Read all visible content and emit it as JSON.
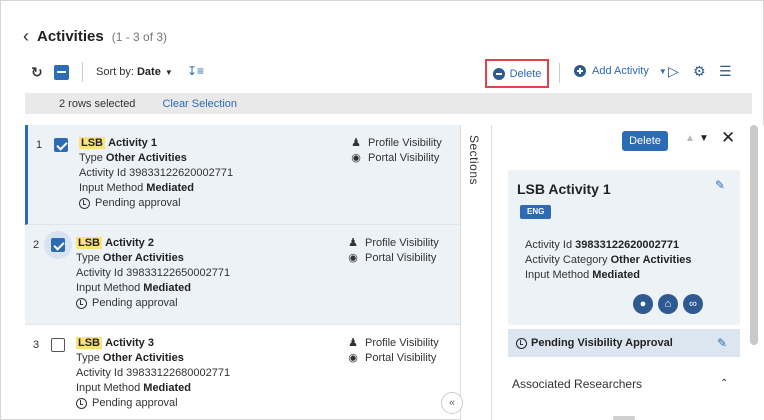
{
  "header": {
    "title": "Activities",
    "count": "(1 - 3 of 3)"
  },
  "toolbar": {
    "sort_by_label": "Sort by:",
    "sort_by_value": "Date",
    "delete_label": "Delete",
    "add_activity_label": "Add Activity"
  },
  "selection": {
    "rows_selected": "2 rows selected",
    "clear_label": "Clear Selection"
  },
  "rows": [
    {
      "num": "1",
      "tag": "LSB",
      "title": "Activity 1",
      "type_label": "Type",
      "type_value": "Other Activities",
      "activity_id": "Activity Id 39833122620002771",
      "input_label": "Input Method",
      "input_value": "Mediated",
      "status": "Pending approval",
      "profile_visibility": "Profile Visibility",
      "portal_visibility": "Portal Visibility",
      "checked": true
    },
    {
      "num": "2",
      "tag": "LSB",
      "title": "Activity 2",
      "type_label": "Type",
      "type_value": "Other Activities",
      "activity_id": "Activity Id 39833122650002771",
      "input_label": "Input Method",
      "input_value": "Mediated",
      "status": "Pending approval",
      "profile_visibility": "Profile Visibility",
      "portal_visibility": "Portal Visibility",
      "checked": true
    },
    {
      "num": "3",
      "tag": "LSB",
      "title": "Activity 3",
      "type_label": "Type",
      "type_value": "Other Activities",
      "activity_id": "Activity Id 39833122680002771",
      "input_label": "Input Method",
      "input_value": "Mediated",
      "status": "Pending approval",
      "profile_visibility": "Profile Visibility",
      "portal_visibility": "Portal Visibility",
      "checked": false
    }
  ],
  "sections_label": "Sections",
  "detail": {
    "delete_label": "Delete",
    "title": "LSB Activity 1",
    "lang_badge": "ENG",
    "activity_id_label": "Activity Id",
    "activity_id_value": "39833122620002771",
    "category_label": "Activity Category",
    "category_value": "Other Activities",
    "input_label": "Input Method",
    "input_value": "Mediated",
    "pending_visibility": "Pending Visibility Approval",
    "associated_researchers": "Associated Researchers"
  },
  "colors": {
    "accent": "#2e6bb5",
    "highlight_tag": "#fbe37a",
    "delete_outline": "#e2424a",
    "selected_row_bg": "#edf2f7"
  },
  "icons": [
    "chevron-left-icon",
    "refresh-icon",
    "sort-direction-icon",
    "minus-circle-icon",
    "plus-circle-icon",
    "export-icon",
    "gear-icon",
    "list-view-icon",
    "person-icon",
    "globe-icon",
    "clock-icon",
    "pencil-icon",
    "user-icon",
    "home-icon",
    "paperclip-icon",
    "close-icon"
  ]
}
